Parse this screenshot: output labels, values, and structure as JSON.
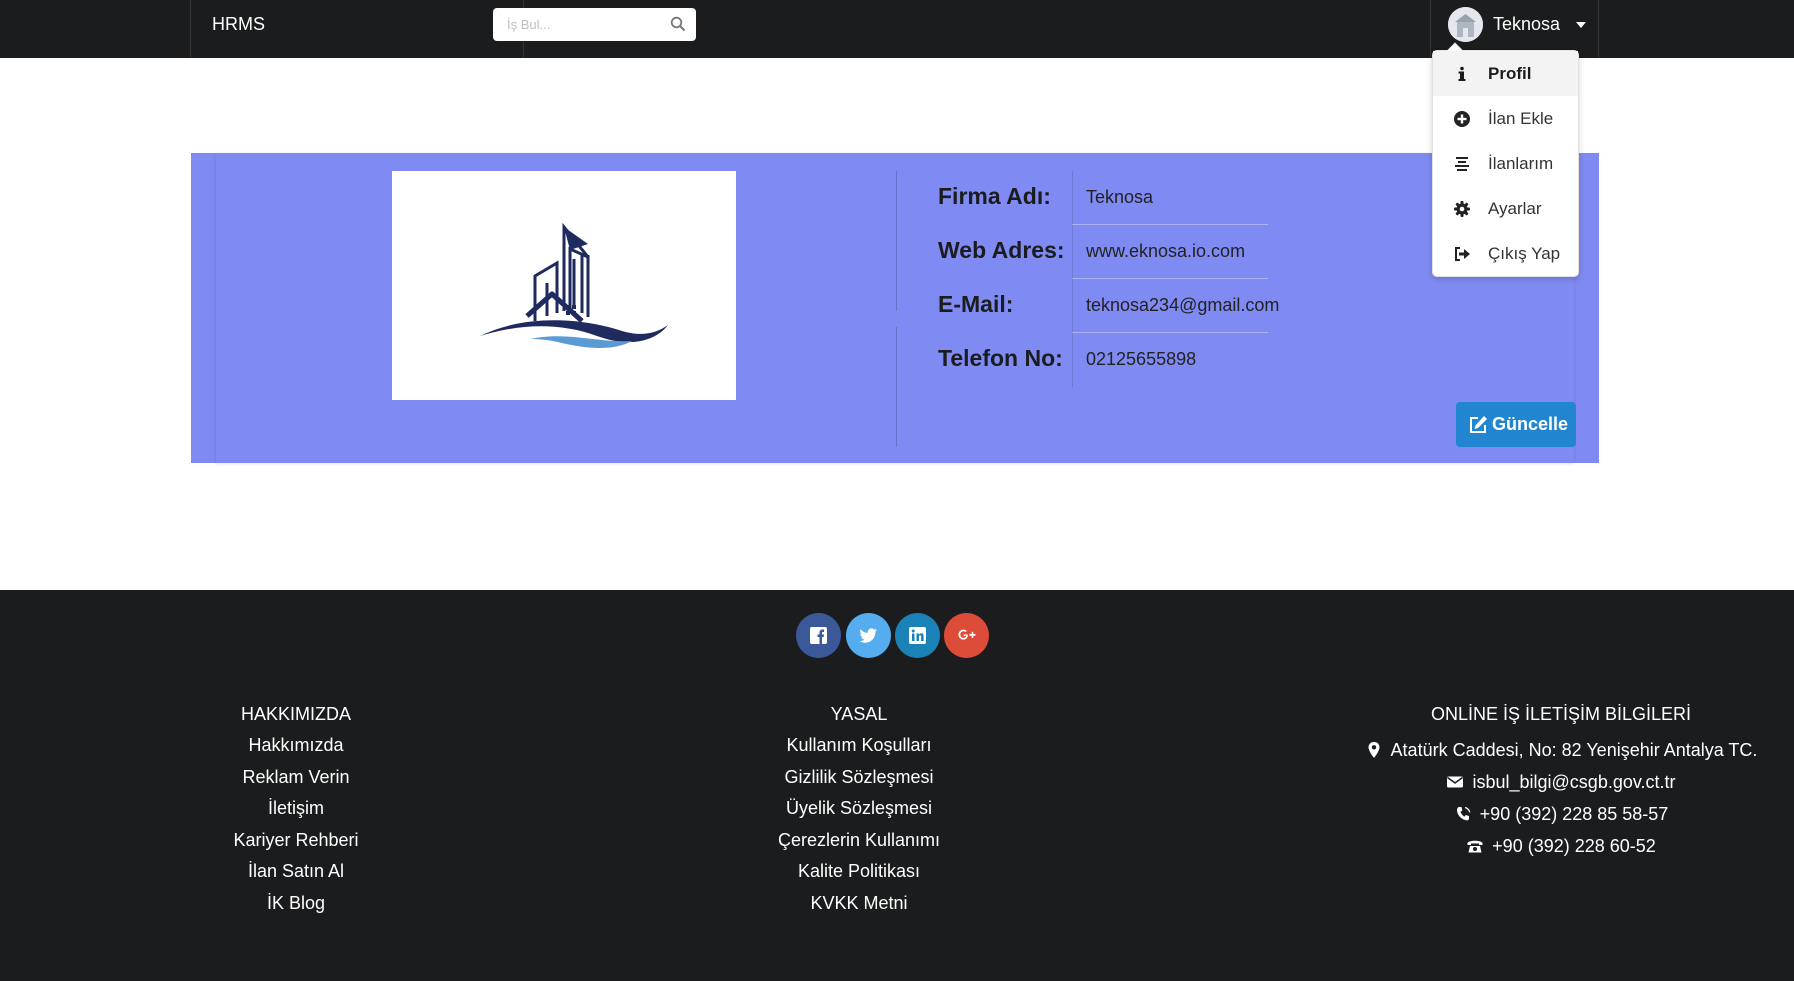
{
  "nav": {
    "brand": "HRMS",
    "search_placeholder": "İş Bul...",
    "search_icon": "search-icon",
    "user_name": "Teknosa",
    "caret_icon": "caret-down-icon"
  },
  "dropdown": {
    "items": [
      {
        "label": "Profil",
        "icon": "info-icon",
        "active": true
      },
      {
        "label": "İlan Ekle",
        "icon": "plus-circle-icon"
      },
      {
        "label": "İlanlarım",
        "icon": "align-center-icon"
      },
      {
        "label": "Ayarlar",
        "icon": "gear-icon"
      },
      {
        "label": "Çıkış Yap",
        "icon": "sign-out-icon"
      }
    ]
  },
  "profile": {
    "rows": [
      {
        "label": "Firma Adı:",
        "value": "Teknosa"
      },
      {
        "label": "Web Adres:",
        "value": "www.eknosa.io.com"
      },
      {
        "label": "E-Mail:",
        "value": "teknosa234@gmail.com"
      },
      {
        "label": "Telefon No:",
        "value": "02125655898"
      }
    ],
    "update_button": "Güncelle",
    "banner_color": "#7f8af2",
    "button_color": "#2185d0"
  },
  "footer": {
    "social": [
      "facebook-icon",
      "twitter-icon",
      "linkedin-icon",
      "google-plus-icon"
    ],
    "about": {
      "heading": "HAKKIMIZDA",
      "links": [
        "Hakkımızda",
        "Reklam Verin",
        "İletişim",
        "Kariyer Rehberi",
        "İlan Satın Al",
        "İK Blog"
      ]
    },
    "legal": {
      "heading": "YASAL",
      "links": [
        "Kullanım Koşulları",
        "Gizlilik Sözleşmesi",
        "Üyelik Sözleşmesi",
        "Çerezlerin Kullanımı",
        "Kalite Politikası",
        "KVKK Metni"
      ]
    },
    "contact": {
      "heading": "ONLİNE İŞ İLETİŞİM BİLGİLERİ",
      "address": "Atatürk Caddesi, No: 82 Yenişehir Antalya TC.",
      "email": "isbul_bilgi@csgb.gov.ct.tr",
      "phone": "+90 (392) 228 85 58-57",
      "fax": "+90 (392) 228 60-52"
    }
  }
}
